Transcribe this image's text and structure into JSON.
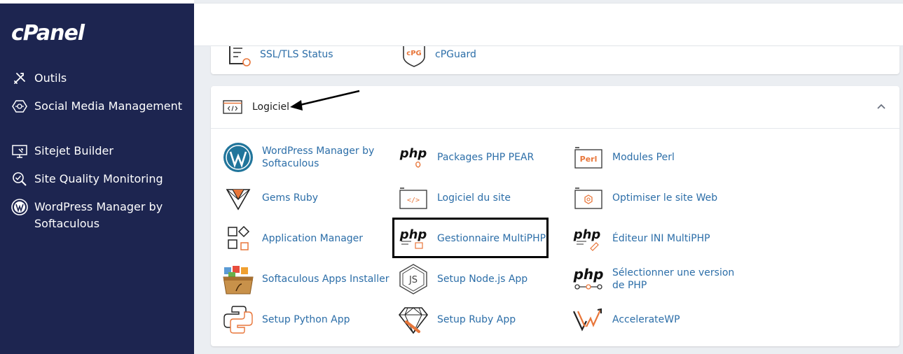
{
  "sidebar": {
    "logo": "cPanel",
    "items": [
      {
        "label": "Outils",
        "icon": "tools-icon"
      },
      {
        "label": "Social Media Management",
        "icon": "social-media-icon"
      },
      {
        "label": "Sitejet Builder",
        "icon": "monitor-icon"
      },
      {
        "label": "Site Quality Monitoring",
        "icon": "search-check-icon"
      },
      {
        "label": "WordPress Manager by Softaculous",
        "icon": "wordpress-icon"
      }
    ]
  },
  "previous_section": {
    "items": [
      "SSL/TLS Status",
      "cPGuard"
    ],
    "cpguard_badge": "cPG"
  },
  "section": {
    "title": "Logiciel",
    "apps": [
      {
        "label": "WordPress Manager by Softaculous"
      },
      {
        "label": "Packages PHP PEAR"
      },
      {
        "label": "Modules Perl"
      },
      {
        "label": "Gems Ruby"
      },
      {
        "label": "Logiciel du site"
      },
      {
        "label": "Optimiser le site Web"
      },
      {
        "label": "Application Manager"
      },
      {
        "label": "Gestionnaire MultiPHP"
      },
      {
        "label": "Éditeur INI MultiPHP"
      },
      {
        "label": "Softaculous Apps Installer"
      },
      {
        "label": "Setup Node.js App"
      },
      {
        "label": "Sélectionner une version de PHP"
      },
      {
        "label": "Setup Python App"
      },
      {
        "label": "Setup Ruby App"
      },
      {
        "label": "AccelerateWP"
      }
    ]
  },
  "icon_text": {
    "php": "php",
    "perl": "Perl",
    "code": "</>",
    "js": "JS"
  },
  "colors": {
    "sidebar_bg": "#1d2550",
    "link": "#2c6ea8",
    "accent_orange": "#e8763a"
  }
}
